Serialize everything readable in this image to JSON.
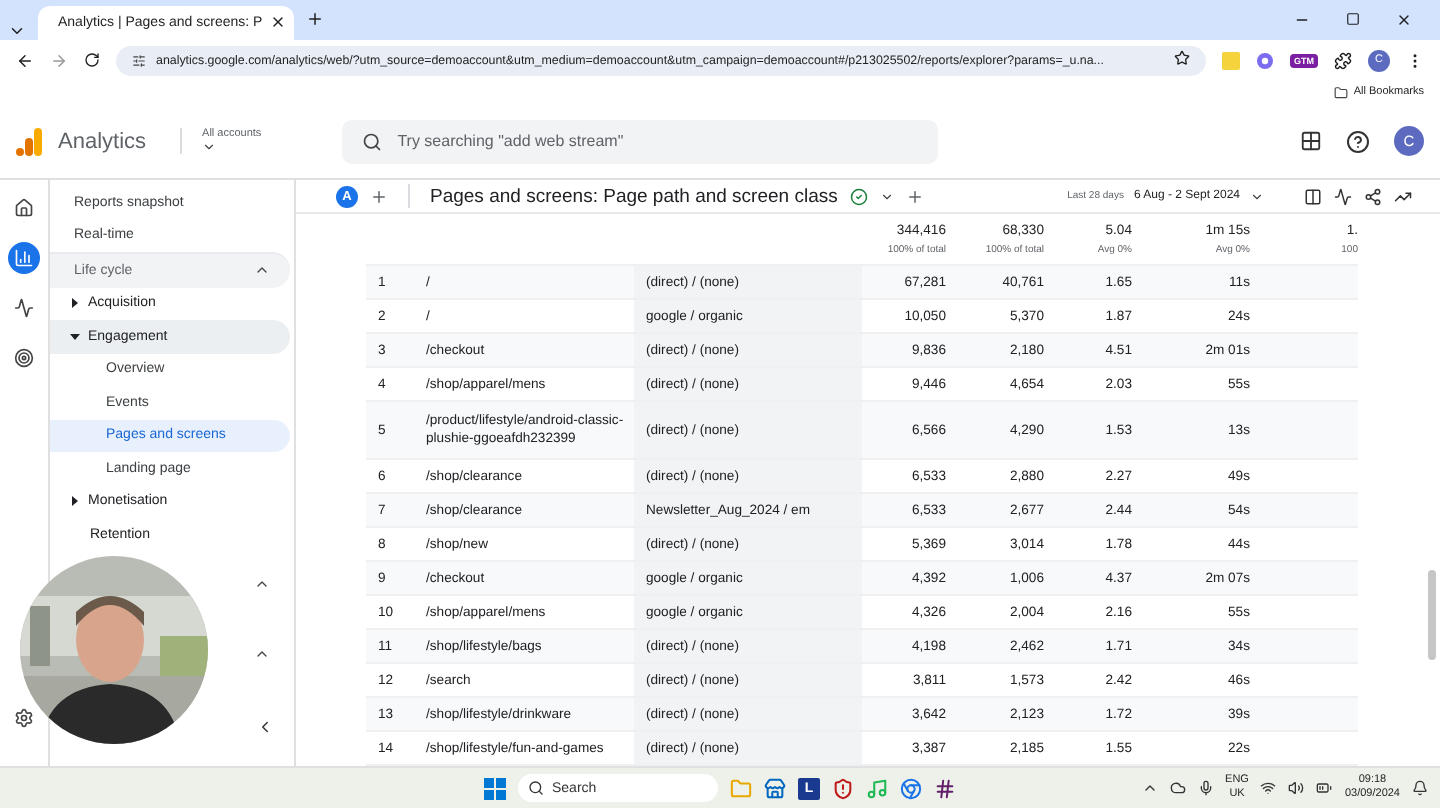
{
  "browser": {
    "tab_title": "Analytics | Pages and screens: P",
    "address": "analytics.google.com/analytics/web/?utm_source=demoaccount&utm_medium=demoaccount&utm_campaign=demoaccount#/p213025502/reports/explorer?params=_u.na...",
    "extension_badge": "GTM",
    "profile": "C",
    "bookmarks": "All Bookmarks"
  },
  "header": {
    "product": "Analytics",
    "account_label": "All accounts",
    "search": {
      "placeholder": "Try searching \"add web stream\""
    },
    "avatar": "C"
  },
  "rail": [
    {
      "kind": "home",
      "selected": false
    },
    {
      "kind": "reports",
      "selected": true
    },
    {
      "kind": "explore",
      "selected": false
    },
    {
      "kind": "advertising",
      "selected": false
    }
  ],
  "sidebar": {
    "links": [
      {
        "label": "Reports snapshot"
      },
      {
        "label": "Real-time"
      }
    ],
    "sections": [
      {
        "label": "Life cycle",
        "expanded": true,
        "items": [
          {
            "label": "Acquisition",
            "expanded": false
          },
          {
            "label": "Engagement",
            "expanded": true,
            "children": [
              {
                "label": "Overview",
                "selected": false
              },
              {
                "label": "Events",
                "selected": false
              },
              {
                "label": "Pages and screens",
                "selected": true
              },
              {
                "label": "Landing page",
                "selected": false
              }
            ]
          },
          {
            "label": "Monetisation",
            "expanded": false
          },
          {
            "label": "Retention"
          }
        ]
      },
      {
        "expanded": true
      },
      {
        "expanded": true
      }
    ]
  },
  "report": {
    "badge": "A",
    "title": "Pages and screens: Page path and screen class",
    "date_label": "Last 28 days",
    "date_range": "6 Aug - 2 Sept 2024"
  },
  "table": {
    "totals": [
      {
        "value": "344,416",
        "note": "100% of total"
      },
      {
        "value": "68,330",
        "note": "100% of total"
      },
      {
        "value": "5.04",
        "note": "Avg 0%"
      },
      {
        "value": "1m 15s",
        "note": "Avg 0%"
      },
      {
        "value": "1.",
        "note": "100"
      }
    ],
    "rows": [
      [
        "1",
        "/",
        "(direct) / (none)",
        "67,281",
        "40,761",
        "1.65",
        "11s"
      ],
      [
        "2",
        "/",
        "google / organic",
        "10,050",
        "5,370",
        "1.87",
        "24s"
      ],
      [
        "3",
        "/checkout",
        "(direct) / (none)",
        "9,836",
        "2,180",
        "4.51",
        "2m 01s"
      ],
      [
        "4",
        "/shop/apparel/mens",
        "(direct) / (none)",
        "9,446",
        "4,654",
        "2.03",
        "55s"
      ],
      [
        "5",
        "/product/lifestyle/android-classic-plushie-ggoeafdh232399",
        "(direct) / (none)",
        "6,566",
        "4,290",
        "1.53",
        "13s"
      ],
      [
        "6",
        "/shop/clearance",
        "(direct) / (none)",
        "6,533",
        "2,880",
        "2.27",
        "49s"
      ],
      [
        "7",
        "/shop/clearance",
        "Newsletter_Aug_2024 / em",
        "6,533",
        "2,677",
        "2.44",
        "54s"
      ],
      [
        "8",
        "/shop/new",
        "(direct) / (none)",
        "5,369",
        "3,014",
        "1.78",
        "44s"
      ],
      [
        "9",
        "/checkout",
        "google / organic",
        "4,392",
        "1,006",
        "4.37",
        "2m 07s"
      ],
      [
        "10",
        "/shop/apparel/mens",
        "google / organic",
        "4,326",
        "2,004",
        "2.16",
        "55s"
      ],
      [
        "11",
        "/shop/lifestyle/bags",
        "(direct) / (none)",
        "4,198",
        "2,462",
        "1.71",
        "34s"
      ],
      [
        "12",
        "/search",
        "(direct) / (none)",
        "3,811",
        "1,573",
        "2.42",
        "46s"
      ],
      [
        "13",
        "/shop/lifestyle/drinkware",
        "(direct) / (none)",
        "3,642",
        "2,123",
        "1.72",
        "39s"
      ],
      [
        "14",
        "/shop/lifestyle/fun-and-games",
        "(direct) / (none)",
        "3,387",
        "2,185",
        "1.55",
        "22s"
      ]
    ]
  },
  "taskbar": {
    "search": {
      "placeholder": "Search"
    },
    "apps": [
      {
        "kind": "files"
      },
      {
        "kind": "store"
      },
      {
        "kind": "letter",
        "label": "L"
      },
      {
        "kind": "shield"
      },
      {
        "kind": "music"
      },
      {
        "kind": "browser"
      },
      {
        "kind": "chat"
      }
    ],
    "language": "ENG",
    "region": "UK",
    "time": "09:18",
    "date": "03/09/2024"
  }
}
